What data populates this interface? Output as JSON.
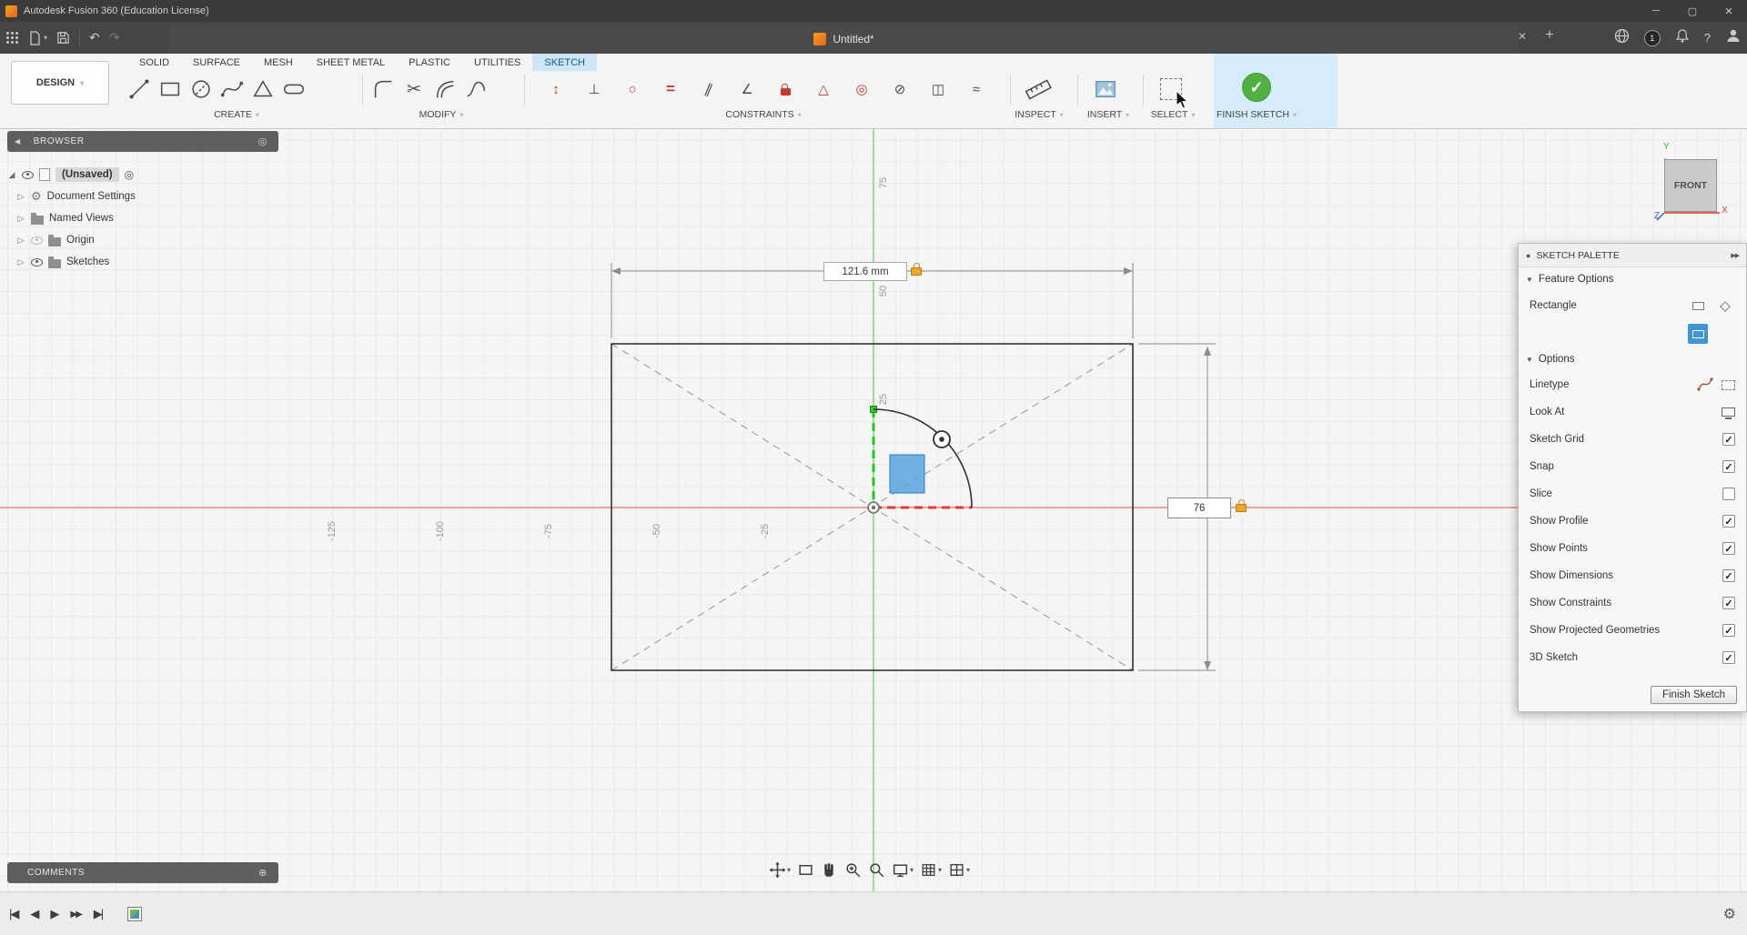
{
  "titlebar": {
    "title": "Autodesk Fusion 360 (Education License)"
  },
  "menubar": {
    "doc_tab": "Untitled*",
    "job_count": "1"
  },
  "ribbon": {
    "design_button": "DESIGN",
    "tabs": [
      {
        "label": "SOLID",
        "active": false
      },
      {
        "label": "SURFACE",
        "active": false
      },
      {
        "label": "MESH",
        "active": false
      },
      {
        "label": "SHEET METAL",
        "active": false
      },
      {
        "label": "PLASTIC",
        "active": false
      },
      {
        "label": "UTILITIES",
        "active": false
      },
      {
        "label": "SKETCH",
        "active": true
      }
    ],
    "groups": {
      "create": "CREATE",
      "modify": "MODIFY",
      "constraints": "CONSTRAINTS",
      "inspect": "INSPECT",
      "insert": "INSERT",
      "select": "SELECT",
      "finish": "FINISH SKETCH"
    }
  },
  "browser": {
    "header": "BROWSER",
    "root_label": "(Unsaved)",
    "items": [
      {
        "label": "Document Settings"
      },
      {
        "label": "Named Views"
      },
      {
        "label": "Origin"
      },
      {
        "label": "Sketches"
      }
    ]
  },
  "canvas": {
    "dim_width": "121.6 mm",
    "dim_height": "76",
    "x_labels": [
      "-125",
      "-100",
      "-75",
      "-50",
      "-25"
    ],
    "y_labels": [
      "75",
      "50",
      "25"
    ],
    "viewcube": {
      "face": "FRONT",
      "axis_y": "Y",
      "axis_x": "X",
      "axis_z": "Z"
    }
  },
  "comments": {
    "header": "COMMENTS"
  },
  "palette": {
    "title": "SKETCH PALETTE",
    "feature_section": "Feature Options",
    "feature_label": "Rectangle",
    "options_section": "Options",
    "options": [
      {
        "label": "Linetype",
        "control": "linetype"
      },
      {
        "label": "Look At",
        "control": "lookat"
      },
      {
        "label": "Sketch Grid",
        "control": "checkbox",
        "checked": true
      },
      {
        "label": "Snap",
        "control": "checkbox",
        "checked": true
      },
      {
        "label": "Slice",
        "control": "checkbox",
        "checked": false
      },
      {
        "label": "Show Profile",
        "control": "checkbox",
        "checked": true
      },
      {
        "label": "Show Points",
        "control": "checkbox",
        "checked": true
      },
      {
        "label": "Show Dimensions",
        "control": "checkbox",
        "checked": true
      },
      {
        "label": "Show Constraints",
        "control": "checkbox",
        "checked": true
      },
      {
        "label": "Show Projected Geometries",
        "control": "checkbox",
        "checked": true
      },
      {
        "label": "3D Sketch",
        "control": "checkbox",
        "checked": true
      }
    ],
    "finish_button": "Finish Sketch"
  },
  "icons": {
    "caret": "▾",
    "undo": "↶",
    "redo": "↷",
    "minimize": "─",
    "maximize": "▢",
    "close": "✕",
    "tab_close": "✕",
    "new_tab": "+",
    "collapse": "◀",
    "target": "◎",
    "add_comment": "⊕",
    "gear": "⚙",
    "tree_collapsed": "▷",
    "tree_root": "◢",
    "palette_dot": "●",
    "expand_right": "▶▶",
    "section_open": "▼",
    "help": "?",
    "trim": "✂",
    "skip_start": "|◀",
    "step_back": "◀",
    "play": "▶",
    "step_forward": "▶▶",
    "skip_end": "▶|"
  }
}
